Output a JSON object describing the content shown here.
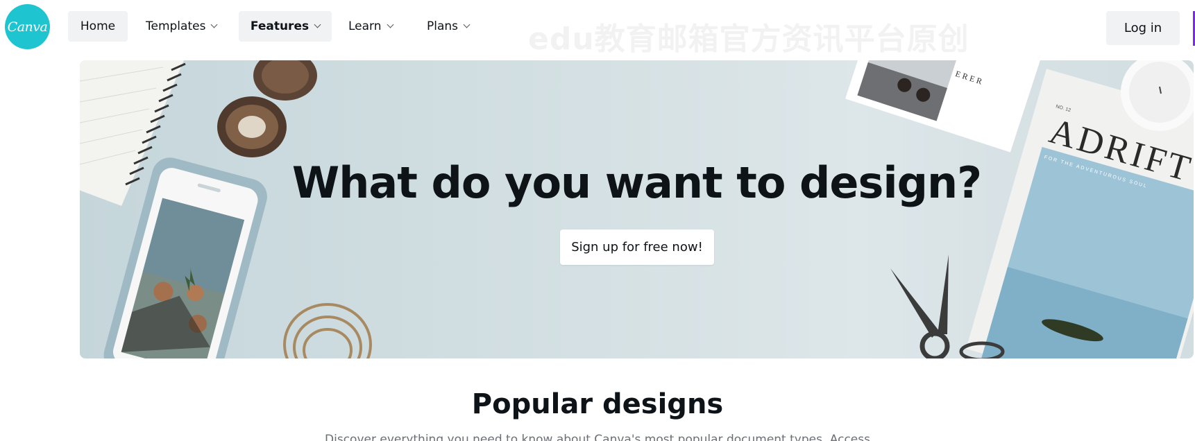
{
  "brand": {
    "logo_text": "Canva",
    "accent": "#1ec4d0"
  },
  "nav": {
    "items": [
      {
        "label": "Home",
        "dropdown": false
      },
      {
        "label": "Templates",
        "dropdown": true
      },
      {
        "label": "Features",
        "dropdown": true
      },
      {
        "label": "Learn",
        "dropdown": true
      },
      {
        "label": "Plans",
        "dropdown": true
      }
    ],
    "login_label": "Log in"
  },
  "watermark": "edu教育邮箱官方资讯平台原创",
  "hero": {
    "title": "What do you want to design?",
    "cta_label": "Sign up for free now!",
    "magazine_title": "ADRIFT",
    "magazine_subtitle": "FOR THE ADVENTUROUS SOUL",
    "magazine_issue": "NO. 12",
    "postcard_text": "ERER"
  },
  "popular": {
    "title": "Popular designs",
    "description": "Discover everything you need to know about Canva's most popular document types. Access"
  },
  "colors": {
    "nav_pill": "#f1f2f4",
    "text": "#0e1318",
    "hero_bg": "#d4e0e3"
  }
}
